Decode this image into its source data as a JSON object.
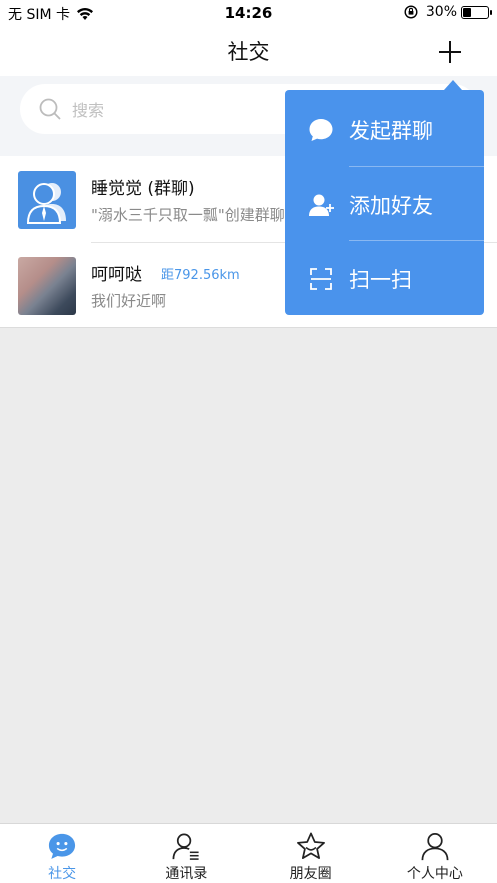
{
  "status_bar": {
    "carrier": "无 SIM 卡",
    "time": "14:26",
    "battery": "30%",
    "battery_level": 0.3
  },
  "nav": {
    "title": "社交",
    "plus_icon": "plus-icon"
  },
  "search": {
    "placeholder": "搜索"
  },
  "conversations": [
    {
      "name": "睡觉觉 (群聊)",
      "preview": "\"溺水三千只取一瓢\"创建群聊",
      "avatar": "group-avatar"
    },
    {
      "name": "呵呵哒",
      "distance": "距792.56km",
      "preview": "我们好近啊",
      "avatar": "photo-avatar"
    }
  ],
  "popup_menu": {
    "items": [
      {
        "label": "发起群聊",
        "icon": "chat-bubble-icon"
      },
      {
        "label": "添加好友",
        "icon": "add-friend-icon"
      },
      {
        "label": "扫一扫",
        "icon": "scan-icon"
      }
    ]
  },
  "tabs": [
    {
      "label": "社交",
      "icon": "chat-face-icon",
      "active": true
    },
    {
      "label": "通讯录",
      "icon": "contacts-icon",
      "active": false
    },
    {
      "label": "朋友圈",
      "icon": "star-icon",
      "active": false
    },
    {
      "label": "个人中心",
      "icon": "person-icon",
      "active": false
    }
  ],
  "colors": {
    "accent": "#4a93ec",
    "accent_text": "#4a96e8",
    "background": "#ececec"
  }
}
